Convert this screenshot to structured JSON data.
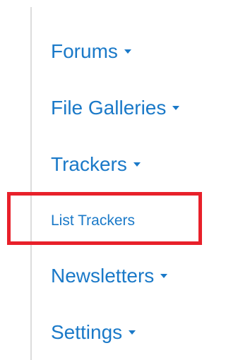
{
  "menu": {
    "items": [
      {
        "label": "Forums",
        "icon": "caret-down-icon"
      },
      {
        "label": "File Galleries",
        "icon": "caret-down-icon"
      },
      {
        "label": "Trackers",
        "icon": "caret-down-icon"
      },
      {
        "label": "Newsletters",
        "icon": "caret-down-icon"
      },
      {
        "label": "Settings",
        "icon": "caret-down-icon"
      }
    ],
    "submenu": {
      "label": "List Trackers"
    }
  },
  "colors": {
    "link": "#1a79c8",
    "highlight": "#e8202a",
    "rail": "#dcdcdc"
  }
}
